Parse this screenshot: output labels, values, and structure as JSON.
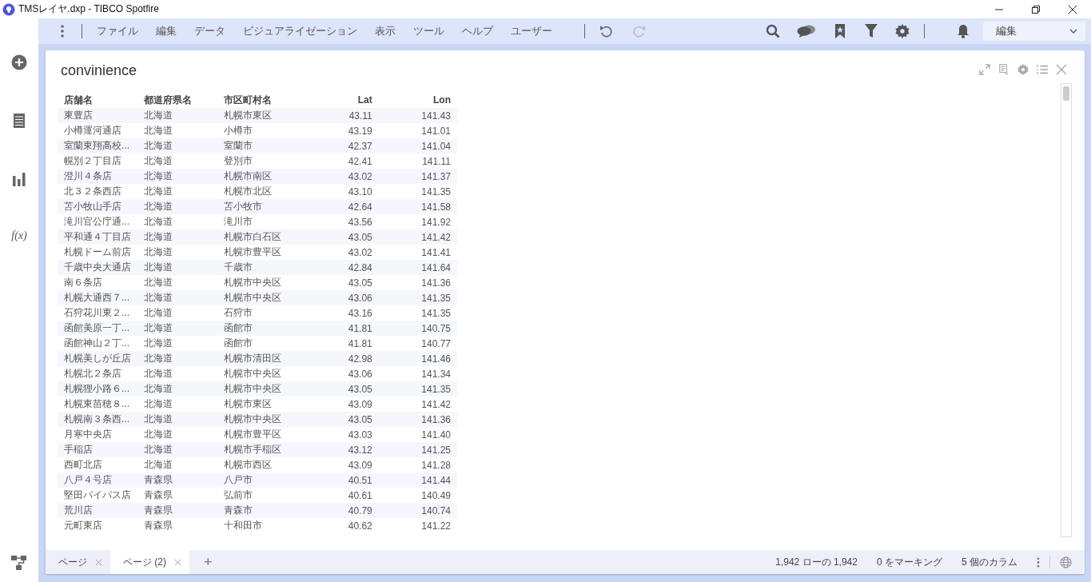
{
  "window": {
    "title": "TMSレイヤ.dxp - TIBCO Spotfire"
  },
  "menu": [
    {
      "label": "ファイル"
    },
    {
      "label": "編集"
    },
    {
      "label": "データ"
    },
    {
      "label": "ビジュアライゼーション"
    },
    {
      "label": "表示"
    },
    {
      "label": "ツール"
    },
    {
      "label": "ヘルプ"
    },
    {
      "label": "ユーザー"
    }
  ],
  "history": {
    "undo_disabled": false,
    "redo_disabled": true
  },
  "mode_selector": {
    "value": "編集"
  },
  "sidebar": {
    "function_label": "f(x)"
  },
  "panel": {
    "title": "convinience",
    "table": {
      "columns": [
        "店舗名",
        "都道府県名",
        "市区町村名",
        "Lat",
        "Lon"
      ],
      "rows": [
        [
          "東豊店",
          "北海道",
          "札幌市東区",
          "43.11",
          "141.43"
        ],
        [
          "小樽運河通店",
          "北海道",
          "小樽市",
          "43.19",
          "141.01"
        ],
        [
          "室蘭東翔高校...",
          "北海道",
          "室蘭市",
          "42.37",
          "141.04"
        ],
        [
          "幌別２丁目店",
          "北海道",
          "登別市",
          "42.41",
          "141.11"
        ],
        [
          "澄川４条店",
          "北海道",
          "札幌市南区",
          "43.02",
          "141.37"
        ],
        [
          "北３２条西店",
          "北海道",
          "札幌市北区",
          "43.10",
          "141.35"
        ],
        [
          "苫小牧山手店",
          "北海道",
          "苫小牧市",
          "42.64",
          "141.58"
        ],
        [
          "滝川官公庁通...",
          "北海道",
          "滝川市",
          "43.56",
          "141.92"
        ],
        [
          "平和通４丁目店",
          "北海道",
          "札幌市白石区",
          "43.05",
          "141.42"
        ],
        [
          "札幌ドーム前店",
          "北海道",
          "札幌市豊平区",
          "43.02",
          "141.41"
        ],
        [
          "千歳中央大通店",
          "北海道",
          "千歳市",
          "42.84",
          "141.64"
        ],
        [
          "南６条店",
          "北海道",
          "札幌市中央区",
          "43.05",
          "141.36"
        ],
        [
          "札幌大通西７...",
          "北海道",
          "札幌市中央区",
          "43.06",
          "141.35"
        ],
        [
          "石狩花川東２...",
          "北海道",
          "石狩市",
          "43.16",
          "141.35"
        ],
        [
          "函館美原一丁...",
          "北海道",
          "函館市",
          "41.81",
          "140.75"
        ],
        [
          "函館神山２丁...",
          "北海道",
          "函館市",
          "41.81",
          "140.77"
        ],
        [
          "札幌美しが丘店",
          "北海道",
          "札幌市清田区",
          "42.98",
          "141.46"
        ],
        [
          "札幌北２条店",
          "北海道",
          "札幌市中央区",
          "43.06",
          "141.34"
        ],
        [
          "札幌狸小路６...",
          "北海道",
          "札幌市中央区",
          "43.05",
          "141.35"
        ],
        [
          "札幌東苗穂８...",
          "北海道",
          "札幌市東区",
          "43.09",
          "141.42"
        ],
        [
          "札幌南３条西...",
          "北海道",
          "札幌市中央区",
          "43.05",
          "141.36"
        ],
        [
          "月寒中央店",
          "北海道",
          "札幌市豊平区",
          "43.03",
          "141.40"
        ],
        [
          "手稲店",
          "北海道",
          "札幌市手稲区",
          "43.12",
          "141.25"
        ],
        [
          "西町北店",
          "北海道",
          "札幌市西区",
          "43.09",
          "141.28"
        ],
        [
          "八戸４号店",
          "青森県",
          "八戸市",
          "40.51",
          "141.44"
        ],
        [
          "堅田バイパス店",
          "青森県",
          "弘前市",
          "40.61",
          "140.49"
        ],
        [
          "荒川店",
          "青森県",
          "青森市",
          "40.79",
          "140.74"
        ],
        [
          "元町東店",
          "青森県",
          "十和田市",
          "40.62",
          "141.22"
        ]
      ]
    }
  },
  "page_tabs": [
    {
      "label": "ページ",
      "selected": false
    },
    {
      "label": "ページ (2)",
      "selected": true
    }
  ],
  "add_tab": "+",
  "status_bar": [
    "1,942 ローの 1,942",
    "0 をマーキング",
    "5 個のカラム"
  ]
}
